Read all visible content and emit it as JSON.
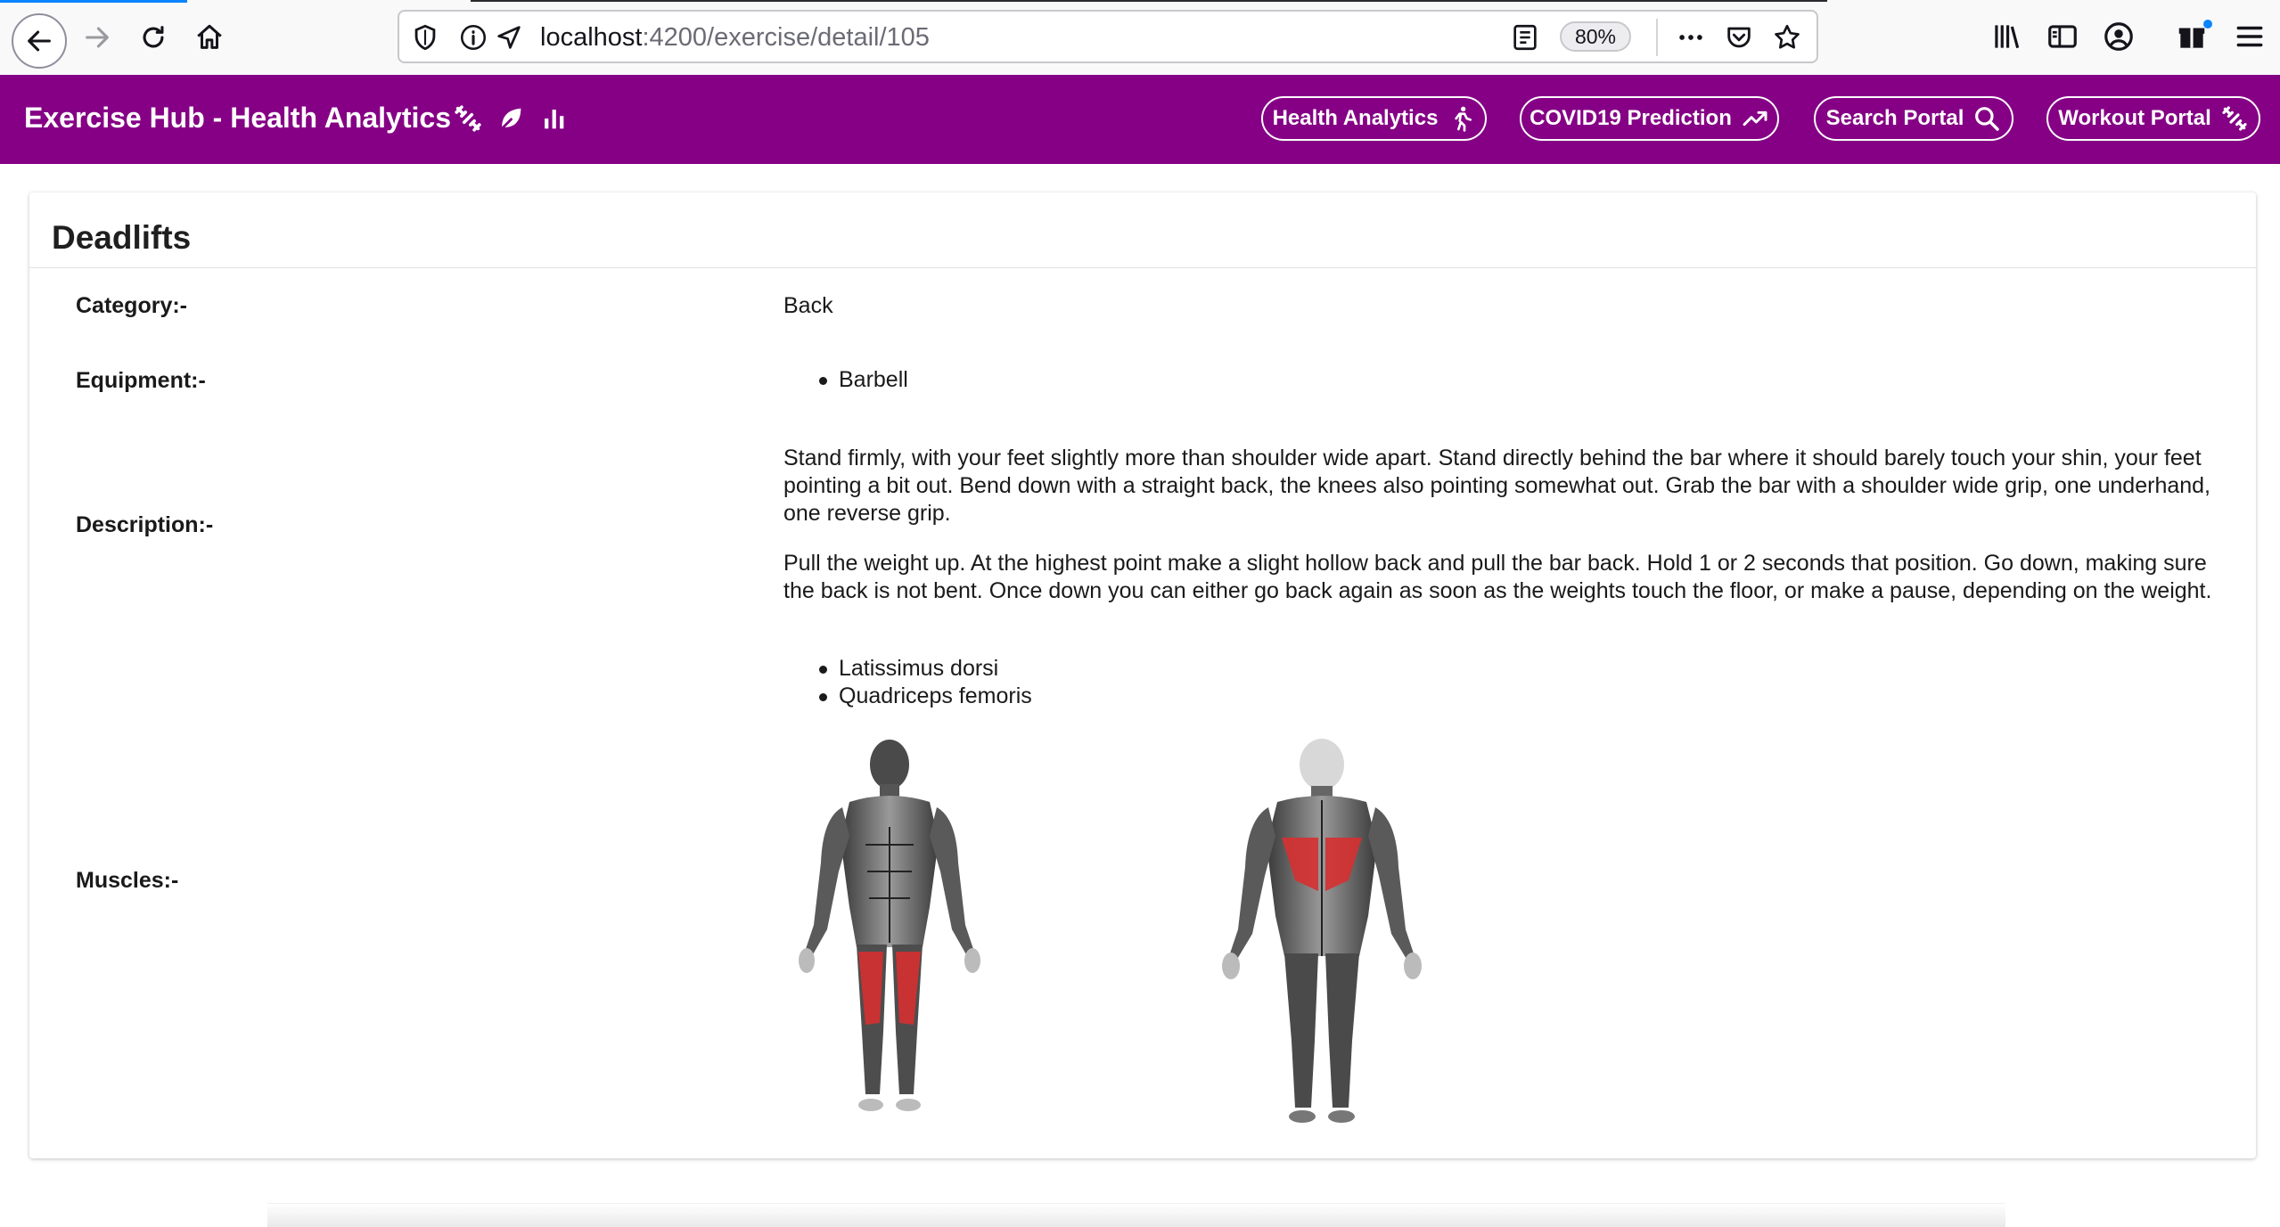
{
  "browser": {
    "url_host": "localhost",
    "url_path": ":4200/exercise/detail/105",
    "zoom": "80%"
  },
  "header": {
    "title": "Exercise Hub - Health Analytics",
    "buttons": [
      {
        "label": "Health Analytics",
        "icon": "running-person-icon"
      },
      {
        "label": "COVID19 Prediction",
        "icon": "trending-up-icon"
      },
      {
        "label": "Search Portal",
        "icon": "search-icon"
      },
      {
        "label": "Workout Portal",
        "icon": "dumbbell-icon"
      }
    ],
    "icons": [
      "dumbbell-icon",
      "leaf-icon",
      "bar-chart-icon"
    ],
    "color": "#850085"
  },
  "exercise": {
    "name": "Deadlifts",
    "category_label": "Category:-",
    "category": "Back",
    "equipment_label": "Equipment:-",
    "equipment": [
      "Barbell"
    ],
    "description_label": "Description:-",
    "description": [
      "Stand firmly, with your feet slightly more than shoulder wide apart. Stand directly behind the bar where it should barely touch your shin, your feet pointing a bit out. Bend down with a straight back, the knees also pointing somewhat out. Grab the bar with a shoulder wide grip, one underhand, one reverse grip.",
      "Pull the weight up. At the highest point make a slight hollow back and pull the bar back. Hold 1 or 2 seconds that position. Go down, making sure the back is not bent. Once down you can either go back again as soon as the weights touch the floor, or make a pause, depending on the weight."
    ],
    "muscles_label": "Muscles:-",
    "muscles": [
      "Latissimus dorsi",
      "Quadriceps femoris"
    ],
    "highlight_color": "#d63031"
  }
}
